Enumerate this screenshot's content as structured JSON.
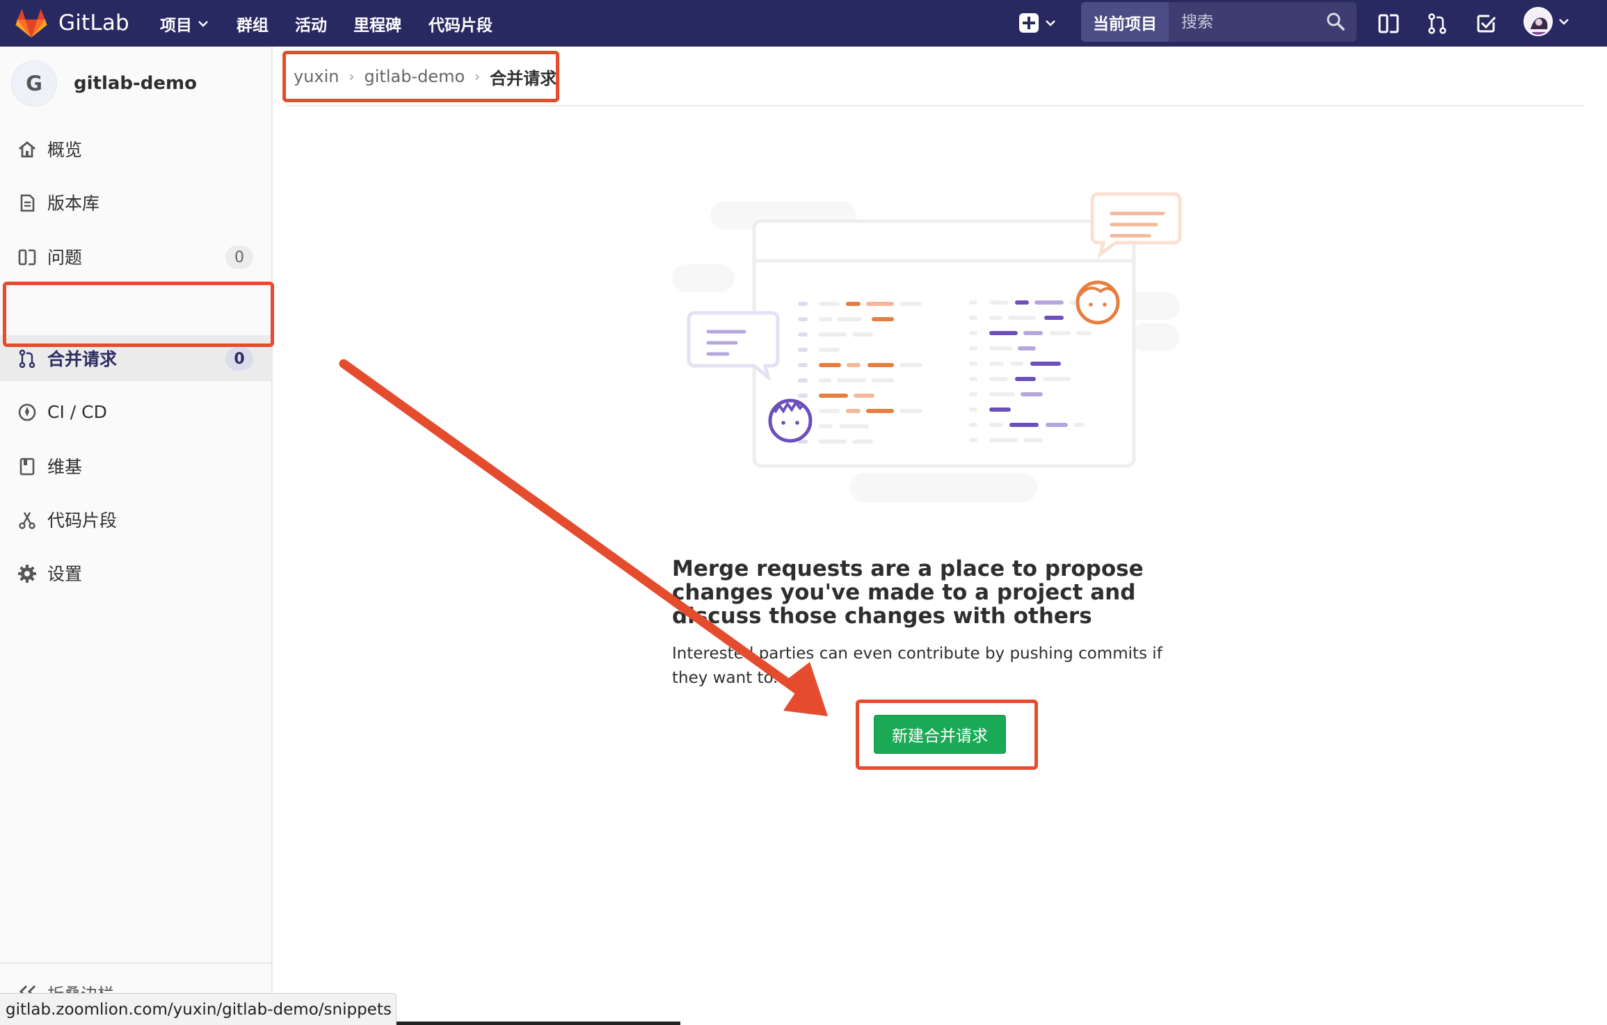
{
  "nav": {
    "brand": "GitLab",
    "items": [
      "项目",
      "群组",
      "活动",
      "里程碑",
      "代码片段"
    ],
    "search_scope": "当前项目",
    "search_placeholder": "搜索",
    "icons": [
      "plus-square-icon",
      "search-icon",
      "issues-icon",
      "merge-request-icon",
      "todo-icon",
      "user-avatar"
    ]
  },
  "sidebar": {
    "project_initial": "G",
    "project_name": "gitlab-demo",
    "items": [
      {
        "label": "概览",
        "icon": "home-icon"
      },
      {
        "label": "版本库",
        "icon": "repository-icon"
      },
      {
        "label": "问题",
        "icon": "issues-icon",
        "count": "0"
      },
      {
        "label": "合并请求",
        "icon": "merge-request-icon",
        "count": "0",
        "active": true
      },
      {
        "label": "CI / CD",
        "icon": "rocket-icon"
      },
      {
        "label": "维基",
        "icon": "book-icon"
      },
      {
        "label": "代码片段",
        "icon": "snippet-icon"
      },
      {
        "label": "设置",
        "icon": "gear-icon"
      }
    ],
    "collapse_label": "折叠边栏"
  },
  "breadcrumb": {
    "items": [
      "yuxin",
      "gitlab-demo",
      "合并请求"
    ]
  },
  "empty_state": {
    "title": "Merge requests are a place to propose changes you've made to a project and discuss those changes with others",
    "subtitle": "Interested parties can even contribute by pushing commits if they want to.",
    "button": "新建合并请求"
  },
  "status_url": "gitlab.zoomlion.com/yuxin/gitlab-demo/snippets",
  "colors": {
    "navbar": "#292961",
    "accent_annotation": "#e54b2d",
    "button_green": "#1aaa55"
  }
}
